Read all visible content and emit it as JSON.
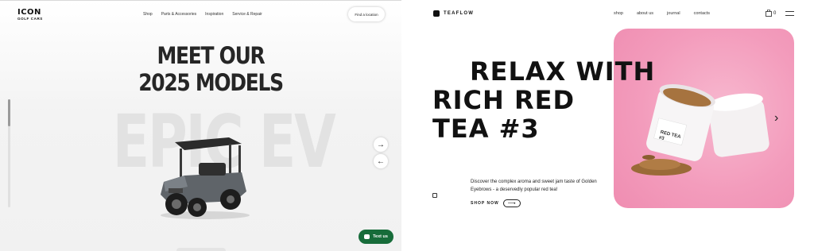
{
  "left": {
    "logo": {
      "main": "ICON",
      "sub": "GOLF CARS"
    },
    "nav": [
      "Shop",
      "Parts & Accessories",
      "Inspiration",
      "Service & Repair"
    ],
    "find_location": "Find a location",
    "heading": [
      "MEET OUR",
      "2025 MODELS"
    ],
    "background_text": "EPIC EV",
    "text_us": "Text us",
    "colors": {
      "text_us_bg": "#176c3a",
      "heading": "#262626"
    },
    "icons": {
      "next": "arrow-right-icon",
      "prev": "arrow-left-icon",
      "chat": "chat-bubble-icon"
    }
  },
  "right": {
    "logo": "TEAFLOW",
    "nav": [
      "shop",
      "about us",
      "journal",
      "contacts"
    ],
    "cart_count": "0",
    "heading": [
      "RELAX WITH",
      "RICH RED",
      "TEA #3"
    ],
    "description": "Discover the complex aroma and sweet jam taste of Golden Eyebrows - a deservedly popular red tea!",
    "shop_now": "SHOP NOW",
    "tin_label": [
      "RED TEA",
      "#3"
    ],
    "colors": {
      "image_bg": "#f39cbc"
    },
    "icons": {
      "cart": "shopping-bag-icon",
      "menu": "hamburger-menu-icon",
      "next": "chevron-right-icon",
      "shop_arrow": "long-arrow-right-icon"
    }
  }
}
